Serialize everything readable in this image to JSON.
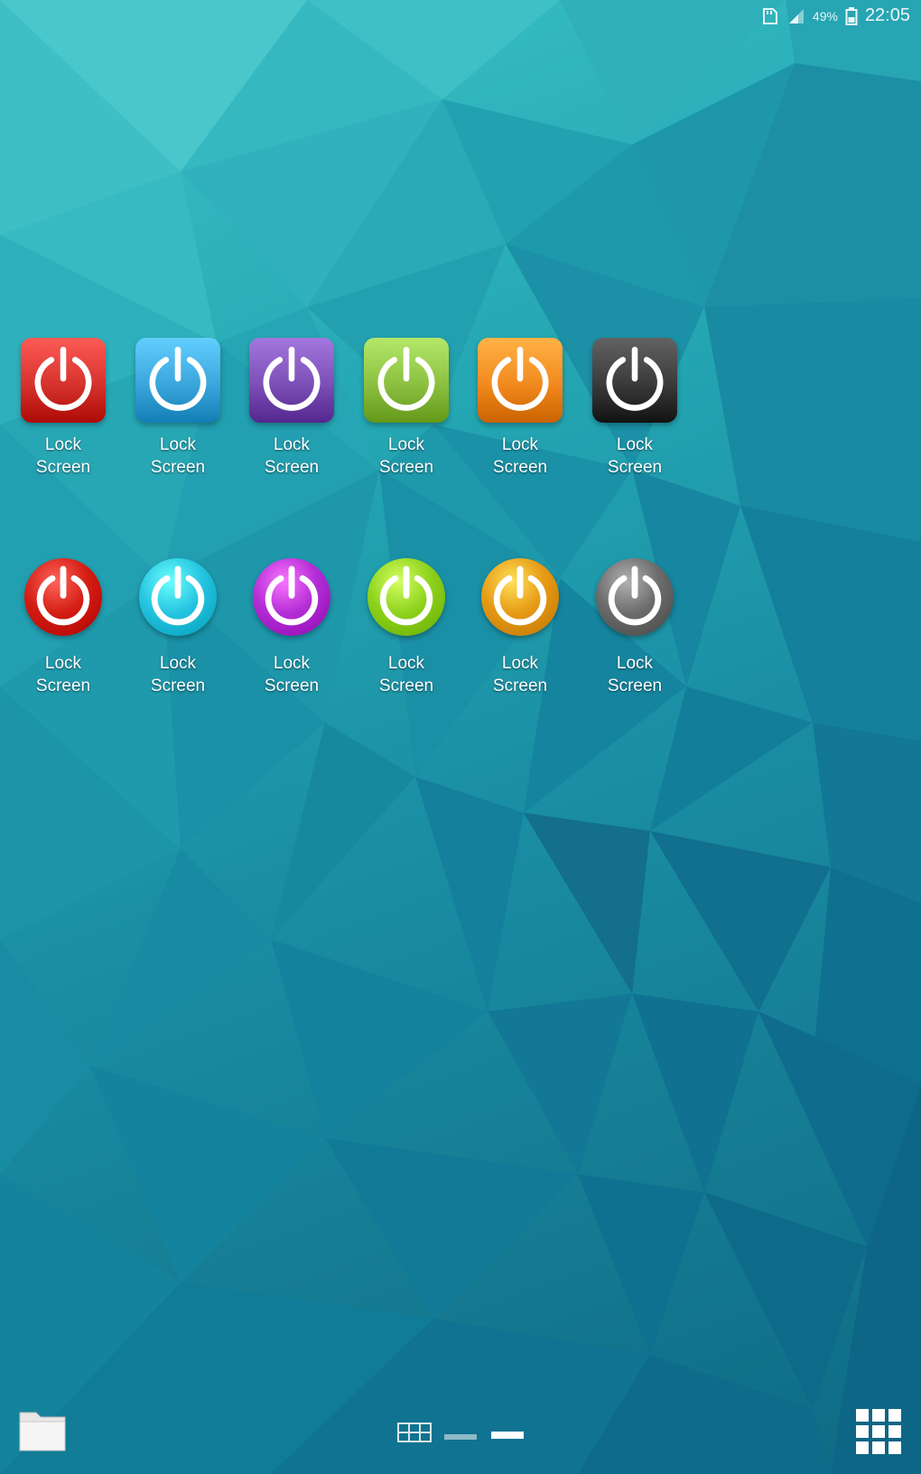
{
  "status_bar": {
    "time": "22:05",
    "battery": "49%",
    "icons": [
      "sd-card-icon",
      "signal-icon",
      "battery-icon"
    ]
  },
  "home_screen": {
    "rows": [
      {
        "style": "square",
        "apps": [
          {
            "label": "Lock\nScreen",
            "color": "#d6322e",
            "icon": "power-icon"
          },
          {
            "label": "Lock\nScreen",
            "color": "#3aa6dc",
            "icon": "power-icon"
          },
          {
            "label": "Lock\nScreen",
            "color": "#7c4fb6",
            "icon": "power-icon"
          },
          {
            "label": "Lock\nScreen",
            "color": "#8cc040",
            "icon": "power-icon"
          },
          {
            "label": "Lock\nScreen",
            "color": "#f28a1e",
            "icon": "power-icon"
          },
          {
            "label": "Lock\nScreen",
            "color": "#3a3a3a",
            "icon": "power-icon"
          }
        ]
      },
      {
        "style": "round",
        "apps": [
          {
            "label": "Lock\nScreen",
            "color": "#d41e14",
            "icon": "power-icon"
          },
          {
            "label": "Lock\nScreen",
            "color": "#25c4e0",
            "icon": "power-icon"
          },
          {
            "label": "Lock\nScreen",
            "color": "#b42ed6",
            "icon": "power-icon"
          },
          {
            "label": "Lock\nScreen",
            "color": "#8ed21c",
            "icon": "power-icon"
          },
          {
            "label": "Lock\nScreen",
            "color": "#e69a14",
            "icon": "power-icon"
          },
          {
            "label": "Lock\nScreen",
            "color": "#6c6c6c",
            "icon": "power-icon"
          }
        ]
      }
    ]
  },
  "bottom_bar": {
    "left_icon": "folder-icon",
    "right_icon": "apps-grid-icon",
    "page_indicators": [
      {
        "icon": "grid-page-icon",
        "active": false
      },
      {
        "icon": "page-dash-icon",
        "active": false
      },
      {
        "icon": "page-dash-icon",
        "active": true
      }
    ]
  }
}
